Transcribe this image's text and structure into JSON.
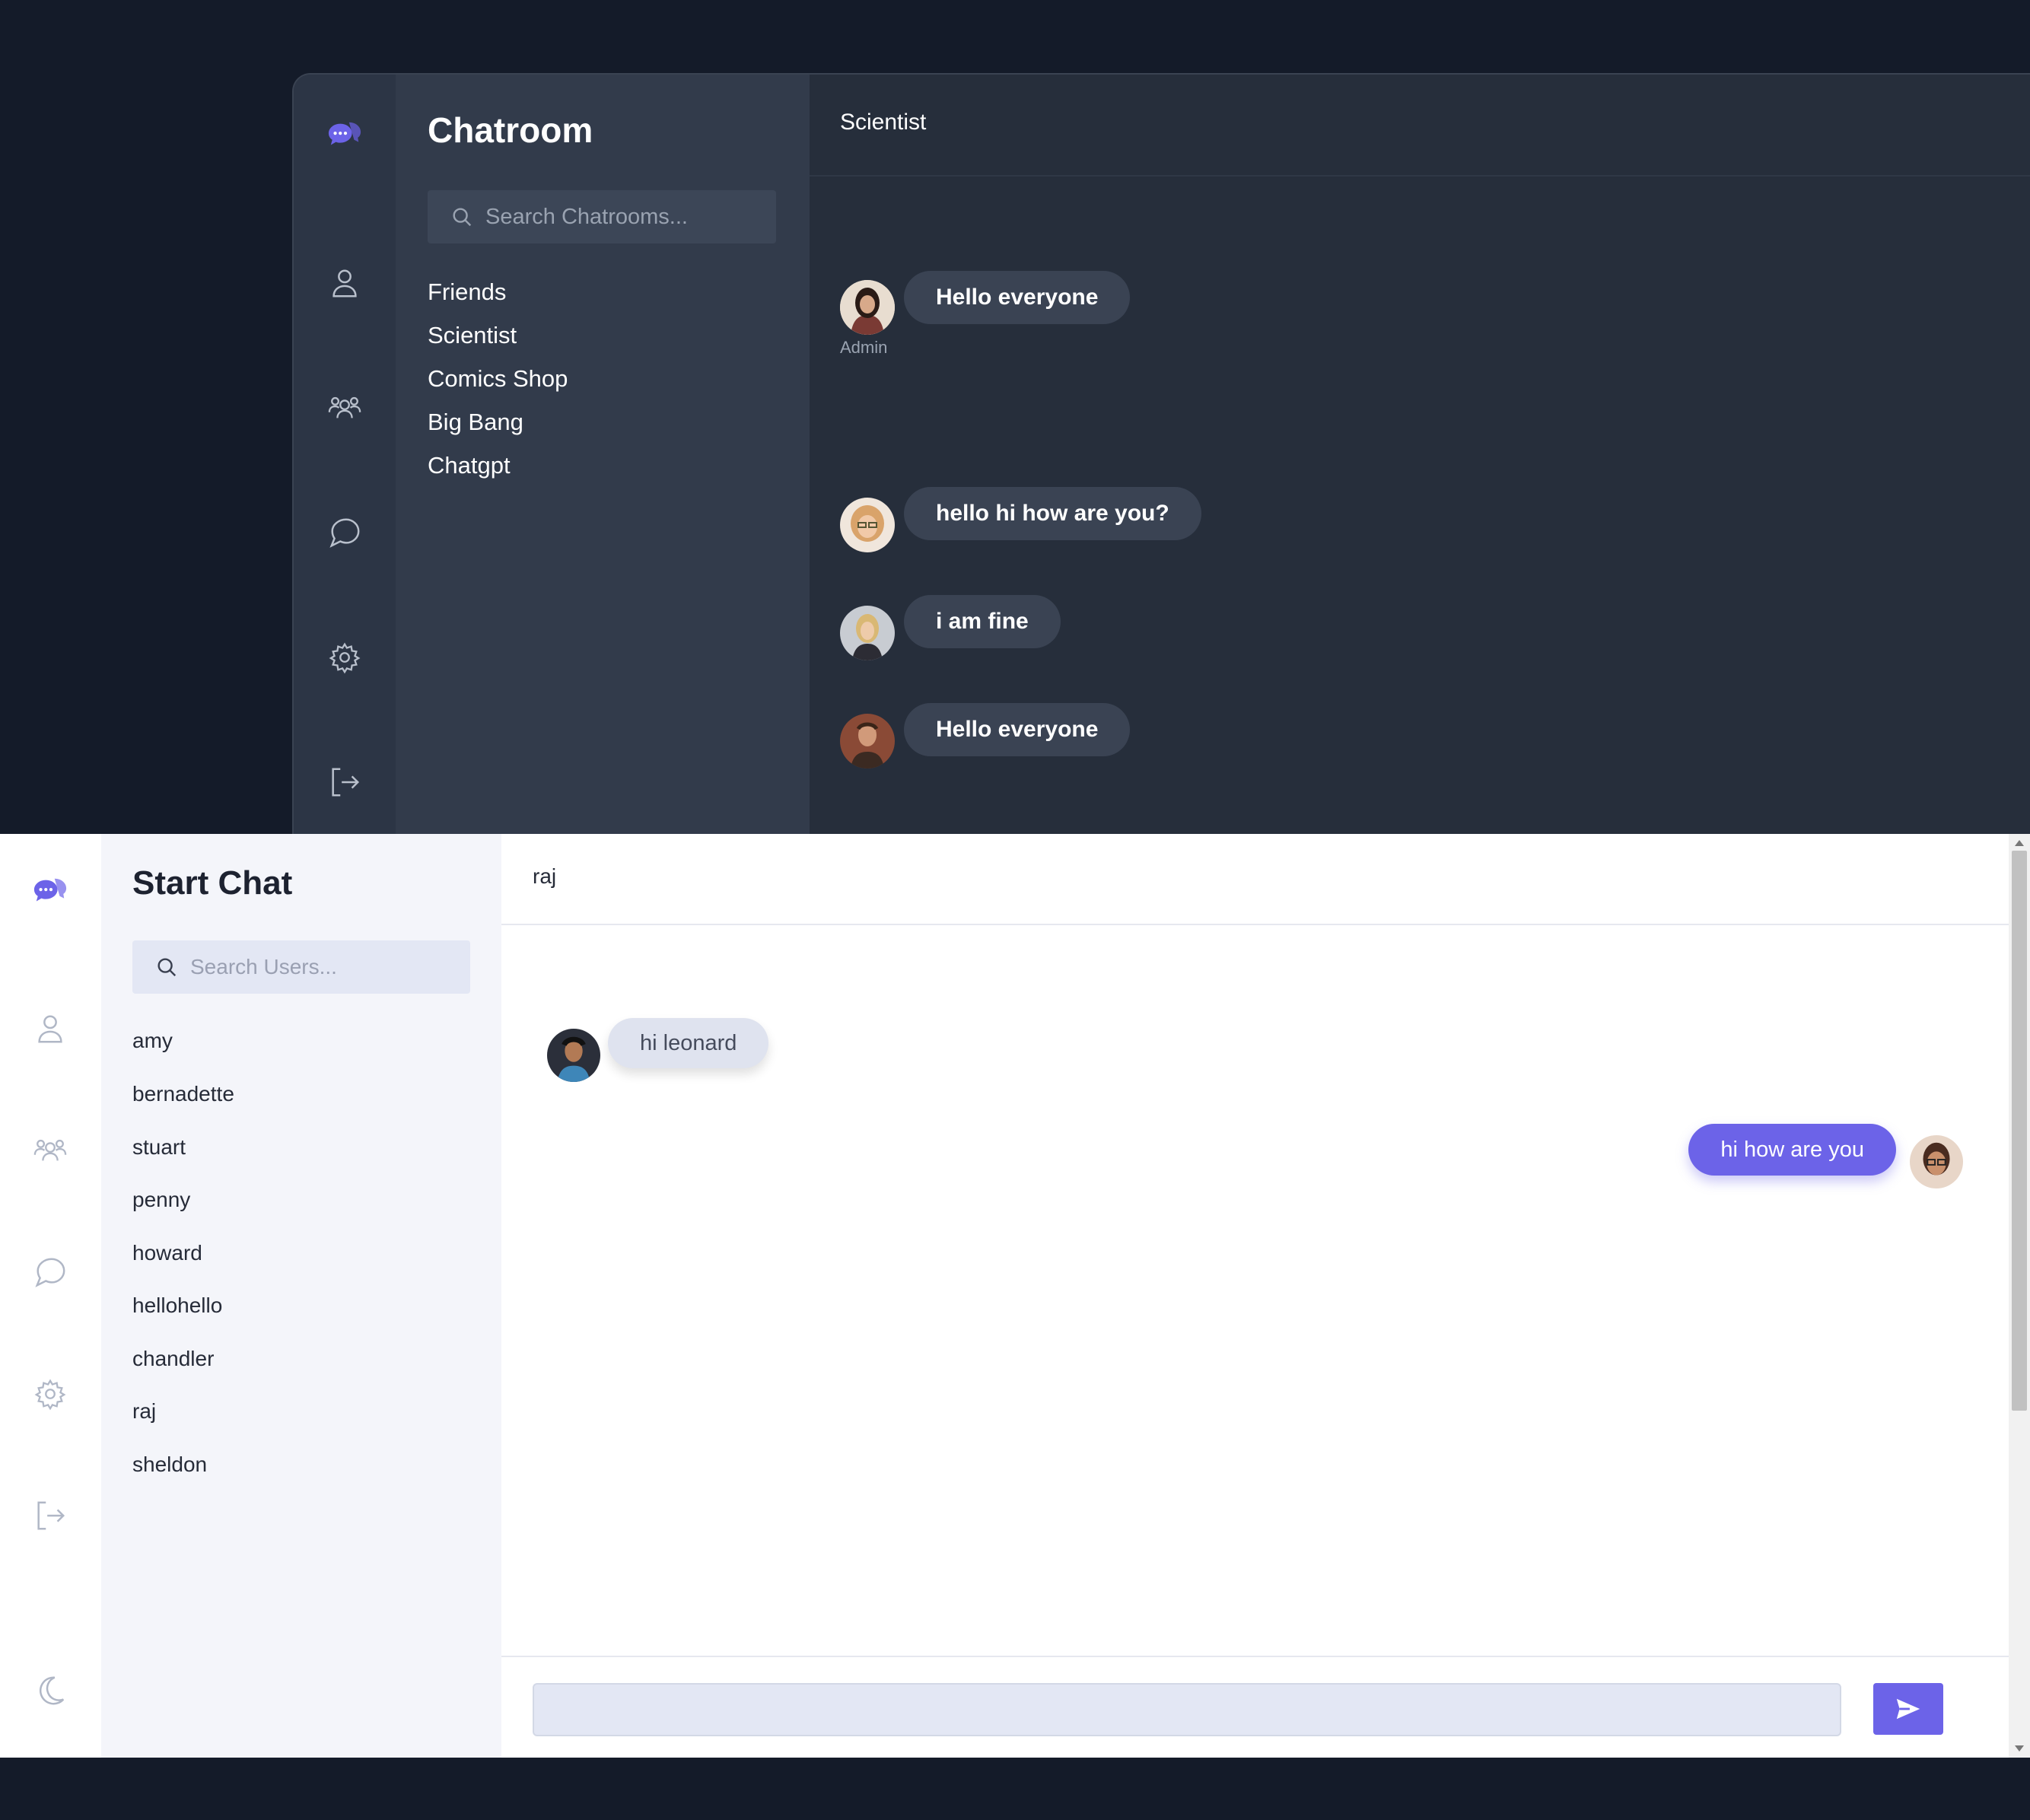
{
  "colors": {
    "accent": "#6c63e8",
    "dark_bg": "#141b29",
    "dark_panel": "#323b4b",
    "light_panel": "#f4f5fa"
  },
  "chatroom_screen": {
    "rail_icons": [
      "chat-logo-icon",
      "user-icon",
      "users-icon",
      "message-icon",
      "gear-icon",
      "logout-icon"
    ],
    "title": "Chatroom",
    "search_placeholder": "Search Chatrooms...",
    "rooms": [
      "Friends",
      "Scientist",
      "Comics Shop",
      "Big Bang",
      "Chatgpt"
    ],
    "active_room": "Scientist",
    "messages": [
      {
        "text": "Hello everyone",
        "sender_label": "Admin"
      },
      {
        "text": "hello hi how are you?"
      },
      {
        "text": "i am fine"
      },
      {
        "text": "Hello everyone"
      }
    ]
  },
  "direct_chat_screen": {
    "rail_icons": [
      "chat-logo-icon",
      "user-icon",
      "users-icon",
      "message-icon",
      "gear-icon",
      "logout-icon",
      "moon-icon"
    ],
    "title": "Start Chat",
    "search_placeholder": "Search Users...",
    "users": [
      "amy",
      "bernadette",
      "stuart",
      "penny",
      "howard",
      "hellohello",
      "chandler",
      "raj",
      "sheldon"
    ],
    "active_user": "raj",
    "messages": [
      {
        "text": "hi leonard",
        "from_me": false
      },
      {
        "text": "hi how are you",
        "from_me": true
      }
    ],
    "composer_value": ""
  }
}
